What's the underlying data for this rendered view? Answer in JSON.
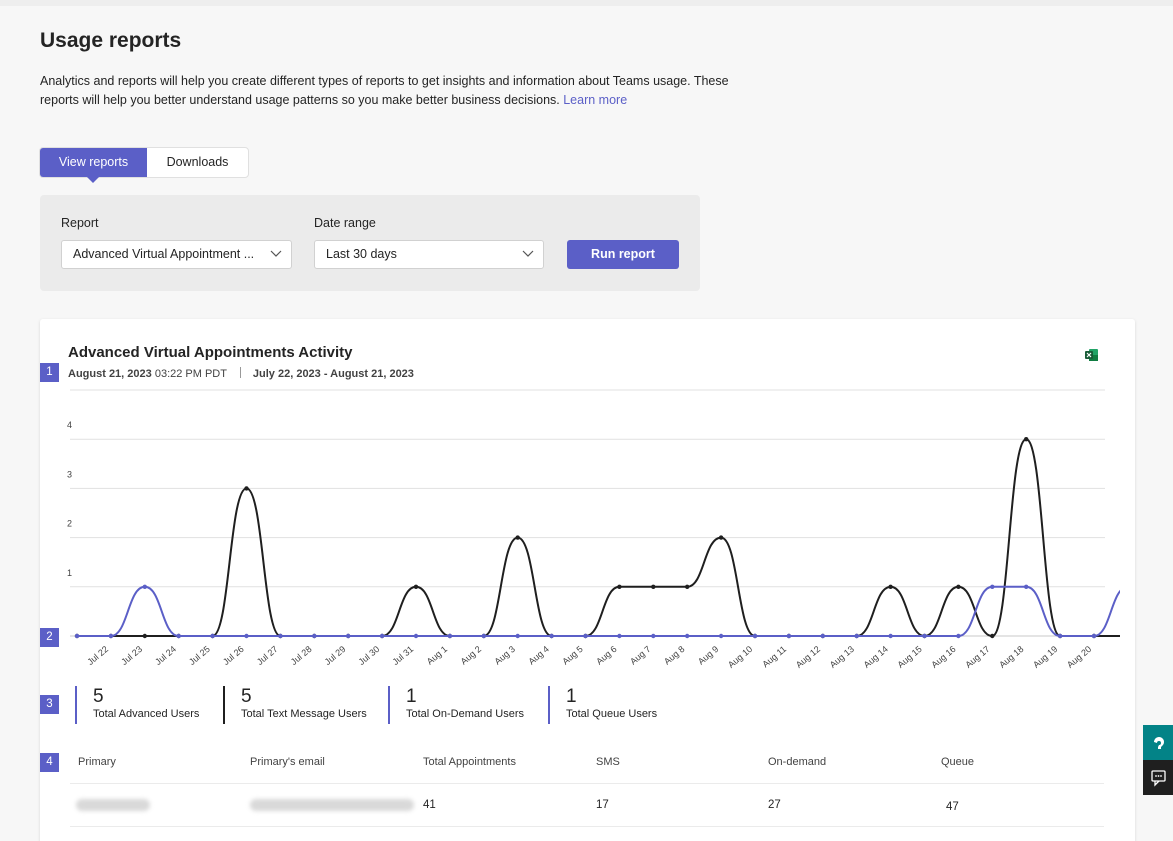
{
  "header": {
    "title": "Usage reports",
    "description": "Analytics and reports will help you create different types of reports to get insights and information about Teams usage. These reports will help you better understand usage patterns so you make better business decisions.",
    "learn_more": "Learn more"
  },
  "tabs": [
    {
      "label": "View reports",
      "active": true
    },
    {
      "label": "Downloads",
      "active": false
    }
  ],
  "filters": {
    "report_label": "Report",
    "report_value": "Advanced Virtual Appointment ...",
    "date_label": "Date range",
    "date_value": "Last 30 days",
    "run_label": "Run report"
  },
  "card": {
    "title": "Advanced Virtual Appointments Activity",
    "date_bold": "August 21, 2023",
    "time": "03:22 PM PDT",
    "range": "July 22, 2023 - August 21, 2023",
    "markers": [
      "1",
      "2",
      "3",
      "4"
    ]
  },
  "chart_data": {
    "type": "line",
    "title": "",
    "xlabel": "",
    "ylabel": "",
    "ylim": [
      0,
      5
    ],
    "yticks": [
      "5",
      "4",
      "3",
      "2",
      "1"
    ],
    "grid": true,
    "categories": [
      "Jul 22",
      "Jul 23",
      "Jul 24",
      "Jul 25",
      "Jul 26",
      "Jul 27",
      "Jul 28",
      "Jul 29",
      "Jul 30",
      "Jul 31",
      "Aug 1",
      "Aug 2",
      "Aug 3",
      "Aug 4",
      "Aug 5",
      "Aug 6",
      "Aug 7",
      "Aug 8",
      "Aug 9",
      "Aug 10",
      "Aug 11",
      "Aug 12",
      "Aug 13",
      "Aug 14",
      "Aug 15",
      "Aug 16",
      "Aug 17",
      "Aug 18",
      "Aug 19",
      "Aug 20"
    ],
    "series": [
      {
        "color": "#1f1f1f",
        "values": [
          0,
          0,
          0,
          0,
          0,
          3,
          0,
          0,
          0,
          0,
          1,
          0,
          0,
          2,
          0,
          0,
          1,
          1,
          1,
          2,
          0,
          0,
          0,
          0,
          1,
          0,
          1,
          0,
          4,
          0,
          0,
          0
        ]
      },
      {
        "color": "#5b5fc7",
        "values": [
          0,
          0,
          1,
          0,
          0,
          0,
          0,
          0,
          0,
          0,
          0,
          0,
          0,
          0,
          0,
          0,
          0,
          0,
          0,
          0,
          0,
          0,
          0,
          0,
          0,
          0,
          0,
          1,
          1,
          0,
          0,
          1
        ]
      }
    ]
  },
  "stats": [
    {
      "value": "5",
      "label": "Total Advanced Users"
    },
    {
      "value": "5",
      "label": "Total Text Message Users"
    },
    {
      "value": "1",
      "label": "Total On-Demand Users"
    },
    {
      "value": "1",
      "label": "Total Queue Users"
    }
  ],
  "table": {
    "columns": [
      "Primary",
      "Primary's email",
      "Total Appointments",
      "SMS",
      "On-demand",
      "Queue"
    ],
    "rows": [
      {
        "total": "41",
        "sms": "17",
        "ondemand": "27",
        "queue": "47"
      }
    ]
  },
  "colors": {
    "accent": "#5b5fc7",
    "excel": "#1d7044",
    "side_teal": "#038387"
  },
  "icons": [
    "chevron-down-icon",
    "excel-icon",
    "help-icon",
    "feedback-icon"
  ]
}
